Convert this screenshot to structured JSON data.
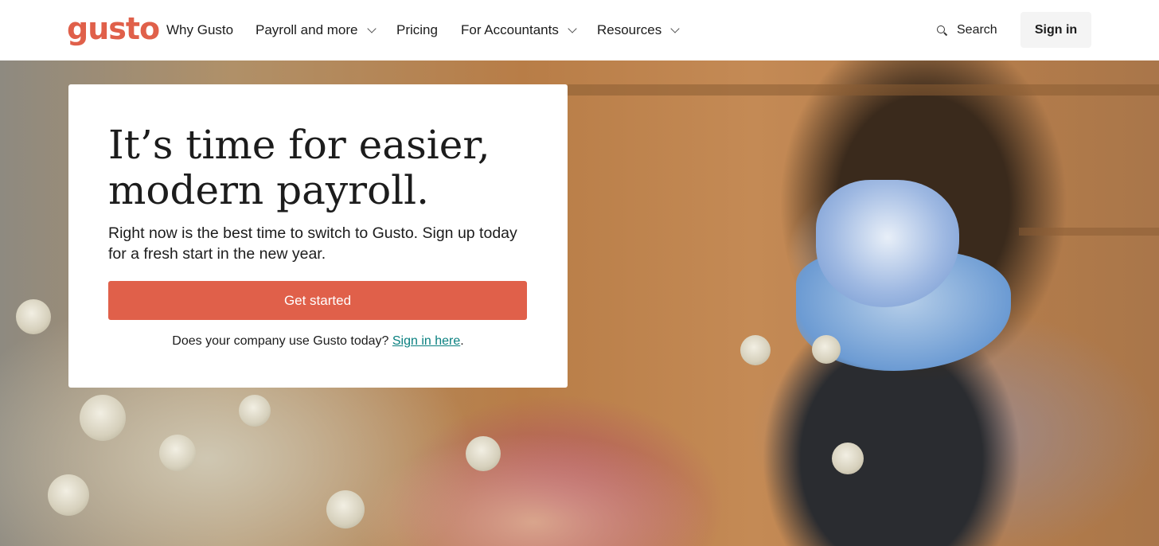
{
  "header": {
    "logo_text": "gusto",
    "nav": [
      {
        "label": "Why Gusto",
        "has_dropdown": false
      },
      {
        "label": "Payroll and more",
        "has_dropdown": true
      },
      {
        "label": "Pricing",
        "has_dropdown": false
      },
      {
        "label": "For Accountants",
        "has_dropdown": true
      },
      {
        "label": "Resources",
        "has_dropdown": true
      }
    ],
    "search_label": "Search",
    "sign_in_label": "Sign in"
  },
  "hero": {
    "headline": "It’s time for easier, modern payroll.",
    "subtext": "Right now is the best time to switch to Gusto. Sign up today for a fresh start in the new year.",
    "cta_label": "Get started",
    "signin_prompt": "Does your company use Gusto today?",
    "signin_link": "Sign in here",
    "signin_suffix": ".",
    "image_icon": "florist-photo"
  },
  "colors": {
    "brand": "#e0604a",
    "link": "#0a8080",
    "text": "#1c1c1c",
    "sign_in_bg": "#f4f4f4"
  }
}
